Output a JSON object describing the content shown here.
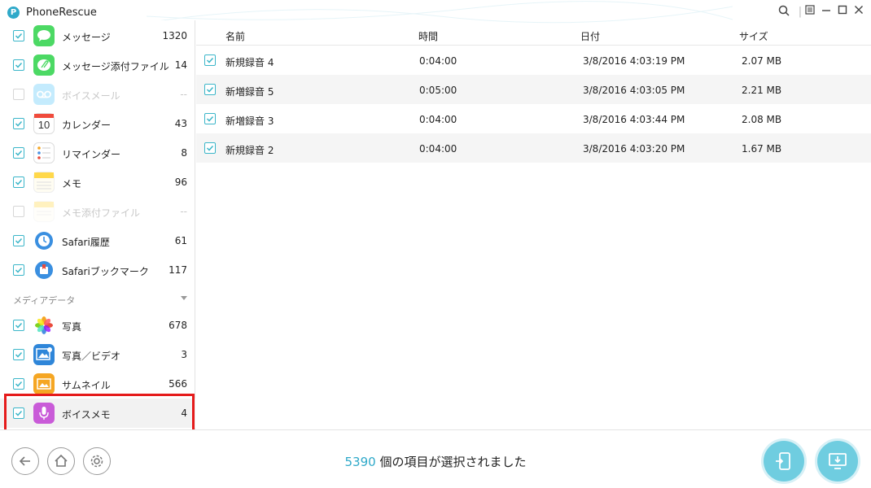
{
  "window": {
    "title": "PhoneRescue",
    "logo_letter": "P"
  },
  "sidebar": {
    "items": [
      {
        "label": "メッセージ",
        "count": "1320",
        "checked": true,
        "icon": "messages-icon",
        "color": "#4cd964"
      },
      {
        "label": "メッセージ添付ファイル",
        "count": "14",
        "checked": true,
        "icon": "message-attachment-icon",
        "color": "#4cd964"
      },
      {
        "label": "ボイスメール",
        "count": "--",
        "checked": false,
        "icon": "voicemail-icon",
        "color": "#5ac8fa"
      },
      {
        "label": "カレンダー",
        "count": "43",
        "checked": true,
        "icon": "calendar-icon",
        "color": "#ffffff"
      },
      {
        "label": "リマインダー",
        "count": "8",
        "checked": true,
        "icon": "reminders-icon",
        "color": "#ffffff"
      },
      {
        "label": "メモ",
        "count": "96",
        "checked": true,
        "icon": "notes-icon",
        "color": "#ffd84a"
      },
      {
        "label": "メモ添付ファイル",
        "count": "--",
        "checked": false,
        "icon": "notes-attachment-icon",
        "color": "#ffd84a"
      },
      {
        "label": "Safari履歴",
        "count": "61",
        "checked": true,
        "icon": "safari-history-icon",
        "color": "#3a8fe0"
      },
      {
        "label": "Safariブックマーク",
        "count": "117",
        "checked": true,
        "icon": "safari-bookmark-icon",
        "color": "#3a8fe0"
      }
    ],
    "section_media": "メディアデータ",
    "media_items": [
      {
        "label": "写真",
        "count": "678",
        "checked": true,
        "icon": "photos-icon",
        "color": "#ffffff"
      },
      {
        "label": "写真／ビデオ",
        "count": "3",
        "checked": true,
        "icon": "photo-video-icon",
        "color": "#2f86d9"
      },
      {
        "label": "サムネイル",
        "count": "566",
        "checked": true,
        "icon": "thumbnail-icon",
        "color": "#f5a623"
      },
      {
        "label": "ボイスメモ",
        "count": "4",
        "checked": true,
        "icon": "voice-memo-icon",
        "color": "#c95bd8"
      }
    ]
  },
  "table": {
    "headers": {
      "name": "名前",
      "time": "時間",
      "date": "日付",
      "size": "サイズ"
    },
    "rows": [
      {
        "name": "新規録音 4",
        "time": "0:04:00",
        "date": "3/8/2016 4:03:19 PM",
        "size": "2.07 MB"
      },
      {
        "name": "新増録音 5",
        "time": "0:05:00",
        "date": "3/8/2016 4:03:05 PM",
        "size": "2.21 MB"
      },
      {
        "name": "新増録音 3",
        "time": "0:04:00",
        "date": "3/8/2016 4:03:44 PM",
        "size": "2.08 MB"
      },
      {
        "name": "新規録音 2",
        "time": "0:04:00",
        "date": "3/8/2016 4:03:20 PM",
        "size": "1.67 MB"
      }
    ]
  },
  "status": {
    "count": "5390",
    "text": " 個の項目が選択されました"
  },
  "colors": {
    "accent": "#2fa9c9",
    "highlight": "#e51b1b",
    "action": "#6fcde0"
  }
}
